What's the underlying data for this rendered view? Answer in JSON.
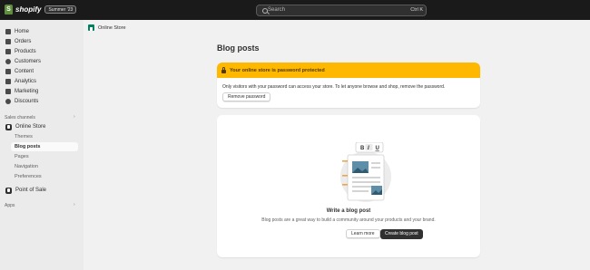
{
  "topbar": {
    "brand": "shopify",
    "brand_mark": "S",
    "edition_badge": "Summer '23",
    "search_placeholder": "Search",
    "search_shortcut": "Ctrl K"
  },
  "sidebar": {
    "main_items": [
      "Home",
      "Orders",
      "Products",
      "Customers",
      "Content",
      "Analytics",
      "Marketing",
      "Discounts"
    ],
    "sales_channels_label": "Sales channels",
    "online_store_label": "Online Store",
    "online_store_subitems": [
      "Themes",
      "Blog posts",
      "Pages",
      "Navigation",
      "Preferences"
    ],
    "active_subitem": "Blog posts",
    "point_of_sale_label": "Point of Sale",
    "apps_label": "Apps"
  },
  "breadcrumb": {
    "label": "Online Store"
  },
  "page": {
    "title": "Blog posts"
  },
  "banner": {
    "title": "Your online store is password protected",
    "body": "Only visitors with your password can access your store. To let anyone browse and shop, remove the password.",
    "button_label": "Remove password",
    "color": "#ffb800"
  },
  "empty_state": {
    "title": "Write a blog post",
    "description": "Blog posts are a great way to build a community around your products and your brand.",
    "learn_more_label": "Learn more",
    "create_label": "Create blog post",
    "toolbar_glyphs": [
      "B",
      "I",
      "U"
    ]
  },
  "colors": {
    "topbar": "#1a1a1a",
    "accent_green": "#008060",
    "illustration_accent": "#e9a64a"
  }
}
